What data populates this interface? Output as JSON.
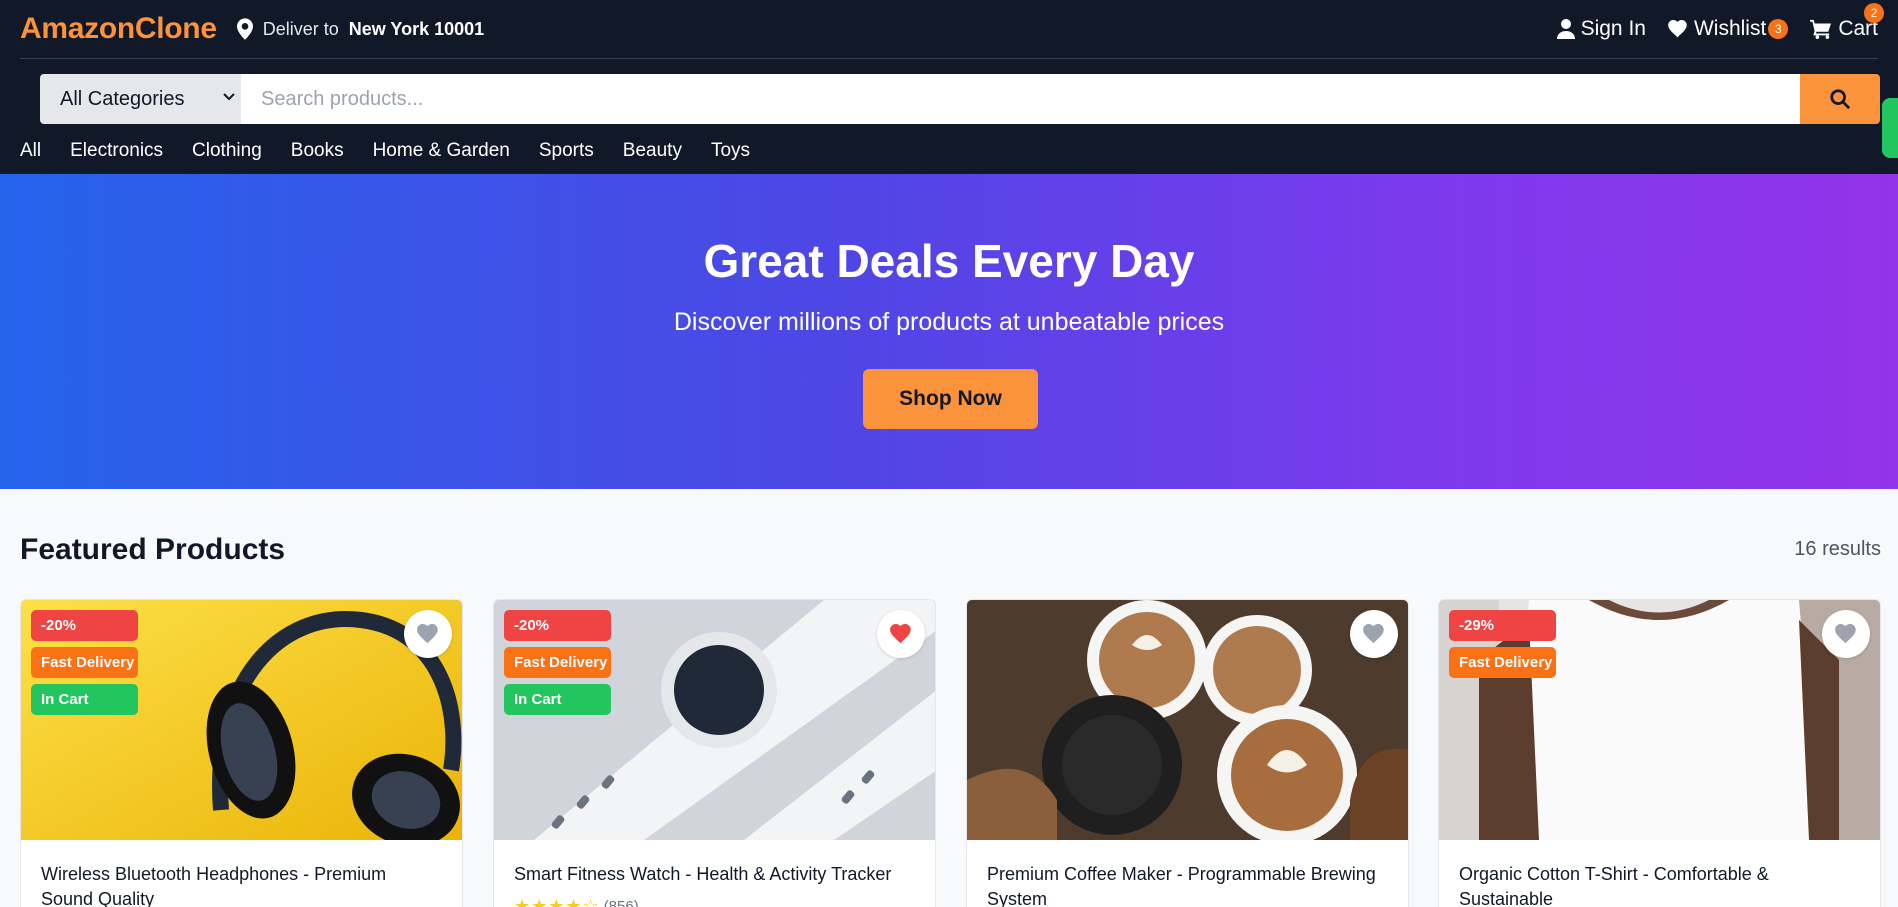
{
  "header": {
    "logo": "AmazonClone",
    "deliver_label": "Deliver to",
    "deliver_location": "New York 10001",
    "sign_in": "Sign In",
    "wishlist": "Wishlist",
    "wishlist_count": "3",
    "cart": "Cart",
    "cart_count": "2"
  },
  "search": {
    "category": "All Categories",
    "placeholder": "Search products..."
  },
  "nav": [
    "All",
    "Electronics",
    "Clothing",
    "Books",
    "Home & Garden",
    "Sports",
    "Beauty",
    "Toys"
  ],
  "hero": {
    "title": "Great Deals Every Day",
    "subtitle": "Discover millions of products at unbeatable prices",
    "cta": "Shop Now"
  },
  "featured": {
    "title": "Featured Products",
    "results": "16 results"
  },
  "products": [
    {
      "title": "Wireless Bluetooth Headphones - Premium Sound Quality",
      "tags": [
        "-20%",
        "Fast Delivery",
        "In Cart"
      ],
      "wishlisted": false
    },
    {
      "title": "Smart Fitness Watch - Health & Activity Tracker",
      "tags": [
        "-20%",
        "Fast Delivery",
        "In Cart"
      ],
      "wishlisted": true,
      "rating": 4,
      "reviews": "(856)"
    },
    {
      "title": "Premium Coffee Maker - Programmable Brewing System",
      "tags": [],
      "wishlisted": false
    },
    {
      "title": "Organic Cotton T-Shirt - Comfortable & Sustainable",
      "tags": [
        "-29%",
        "Fast Delivery"
      ],
      "wishlisted": false
    }
  ],
  "colors": {
    "header_bg": "#111827",
    "accent": "#fb923c",
    "badge": "#f97316",
    "discount_tag": "#ef4444",
    "in_cart_tag": "#22c55e",
    "hero_gradient_start": "#2563eb",
    "hero_gradient_end": "#9333ea"
  },
  "icons": [
    "location-pin-icon",
    "user-icon",
    "heart-icon",
    "cart-icon",
    "chevron-down-icon",
    "search-icon"
  ]
}
